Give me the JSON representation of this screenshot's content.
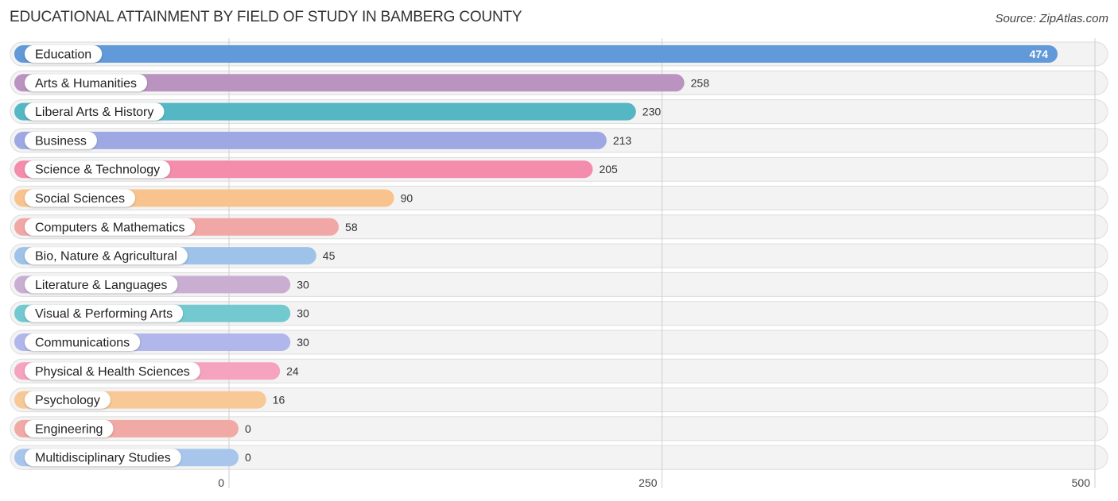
{
  "chart_data": {
    "type": "bar",
    "orientation": "horizontal",
    "title": "EDUCATIONAL ATTAINMENT BY FIELD OF STUDY IN BAMBERG COUNTY",
    "source": "Source: ZipAtlas.com",
    "xlabel": "",
    "ylabel": "",
    "xlim": [
      0,
      500
    ],
    "xticks": [
      0,
      250,
      500
    ],
    "xtick_labels": [
      "0",
      "250",
      "500"
    ],
    "grid": true,
    "legend": "none",
    "categories": [
      "Education",
      "Arts & Humanities",
      "Liberal Arts & History",
      "Business",
      "Science & Technology",
      "Social Sciences",
      "Computers & Mathematics",
      "Bio, Nature & Agricultural",
      "Literature & Languages",
      "Visual & Performing Arts",
      "Communications",
      "Physical & Health Sciences",
      "Psychology",
      "Engineering",
      "Multidisciplinary Studies"
    ],
    "values": [
      474,
      258,
      230,
      213,
      205,
      90,
      58,
      45,
      30,
      30,
      30,
      24,
      16,
      0,
      0
    ],
    "colors": [
      "#6199d9",
      "#bb93c0",
      "#56b7c4",
      "#9ea8e3",
      "#f48cac",
      "#f9c38d",
      "#f0a7a5",
      "#9fc2e8",
      "#c9aed2",
      "#72c9cf",
      "#b1b7ea",
      "#f5a3be",
      "#f9c897",
      "#f0a9a5",
      "#a8c6ec"
    ],
    "value_label_inside_first": true
  }
}
